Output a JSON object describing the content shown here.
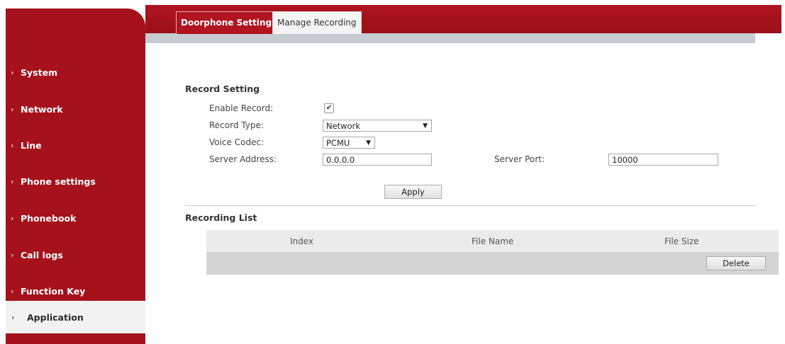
{
  "sidebar": {
    "items": [
      {
        "label": "System"
      },
      {
        "label": "Network"
      },
      {
        "label": "Line"
      },
      {
        "label": "Phone settings"
      },
      {
        "label": "Phonebook"
      },
      {
        "label": "Call logs"
      },
      {
        "label": "Function Key"
      },
      {
        "label": "Application"
      }
    ],
    "chevron": "›",
    "active": "Application"
  },
  "tabs": [
    {
      "label": "Doorphone Settings",
      "active": true
    },
    {
      "label": "Manage Recording",
      "active": false
    }
  ],
  "record_setting": {
    "title": "Record Setting",
    "enable_record_label": "Enable Record:",
    "enable_record_checked": true,
    "check_glyph": "✔",
    "record_type_label": "Record Type:",
    "record_type_value": "Network",
    "voice_codec_label": "Voice Codec:",
    "voice_codec_value": "PCMU",
    "server_address_label": "Server Address:",
    "server_address_value": "0.0.0.0",
    "server_port_label": "Server Port:",
    "server_port_value": "10000",
    "apply_label": "Apply",
    "dropdown_arrow": "▼"
  },
  "recording_list": {
    "title": "Recording List",
    "columns": [
      "Index",
      "File Name",
      "File Size"
    ],
    "delete_label": "Delete"
  },
  "colors": {
    "brand_red": "#a5121c",
    "header_red": "#b01520"
  }
}
